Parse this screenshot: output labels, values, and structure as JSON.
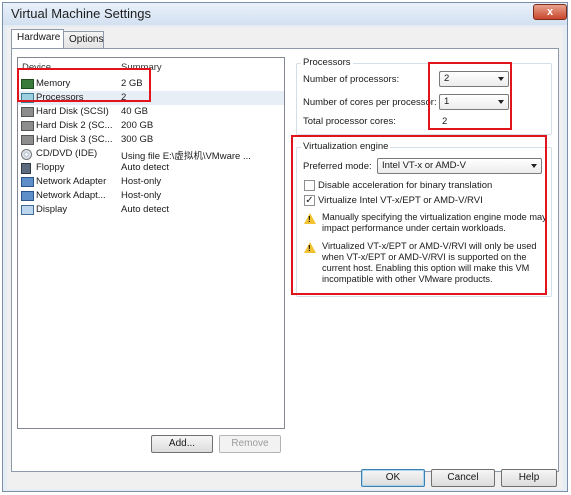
{
  "window": {
    "title": "Virtual Machine Settings",
    "close_glyph": "x"
  },
  "tabs": [
    {
      "label": "Hardware"
    },
    {
      "label": "Options"
    }
  ],
  "device_table": {
    "columns": [
      "Device",
      "Summary"
    ],
    "rows": [
      {
        "name": "Memory",
        "summary": "2 GB",
        "icon": "memory-icon"
      },
      {
        "name": "Processors",
        "summary": "2",
        "icon": "processor-icon"
      },
      {
        "name": "Hard Disk (SCSI)",
        "summary": "40 GB",
        "icon": "hard-disk-icon"
      },
      {
        "name": "Hard Disk 2 (SC...",
        "summary": "200 GB",
        "icon": "hard-disk-icon"
      },
      {
        "name": "Hard Disk 3 (SC...",
        "summary": "300 GB",
        "icon": "hard-disk-icon"
      },
      {
        "name": "CD/DVD (IDE)",
        "summary": "Using file E:\\虚拟机\\VMware ...",
        "icon": "cd-dvd-icon"
      },
      {
        "name": "Floppy",
        "summary": "Auto detect",
        "icon": "floppy-icon"
      },
      {
        "name": "Network Adapter",
        "summary": "Host-only",
        "icon": "network-adapter-icon"
      },
      {
        "name": "Network Adapt...",
        "summary": "Host-only",
        "icon": "network-adapter-icon"
      },
      {
        "name": "Display",
        "summary": "Auto detect",
        "icon": "display-icon"
      }
    ]
  },
  "list_buttons": {
    "add": "Add...",
    "remove": "Remove"
  },
  "processors": {
    "title": "Processors",
    "num_processors_label": "Number of processors:",
    "num_processors_value": "2",
    "cores_label": "Number of cores per processor:",
    "cores_value": "1",
    "total_label": "Total processor cores:",
    "total_value": "2"
  },
  "virtualization": {
    "title": "Virtualization engine",
    "mode_label": "Preferred mode:",
    "mode_value": "Intel VT-x or AMD-V",
    "disable_accel_label": "Disable acceleration for binary translation",
    "disable_accel_checked": false,
    "virtualize_label": "Virtualize Intel VT-x/EPT or AMD-V/RVI",
    "virtualize_checked": true,
    "virtualize_check_glyph": "✓",
    "warning_glyph": "!",
    "warning1": "Manually specifying the virtualization engine mode may impact performance under certain workloads.",
    "warning2": "Virtualized VT-x/EPT or AMD-V/RVI will only be used when VT-x/EPT or AMD-V/RVI is supported on the current host. Enabling this option will make this VM incompatible with other VMware products."
  },
  "dialog_buttons": {
    "ok": "OK",
    "cancel": "Cancel",
    "help": "Help"
  },
  "colors": {
    "annotation_red": "#e0141a",
    "accent": "#3c7fb1"
  }
}
